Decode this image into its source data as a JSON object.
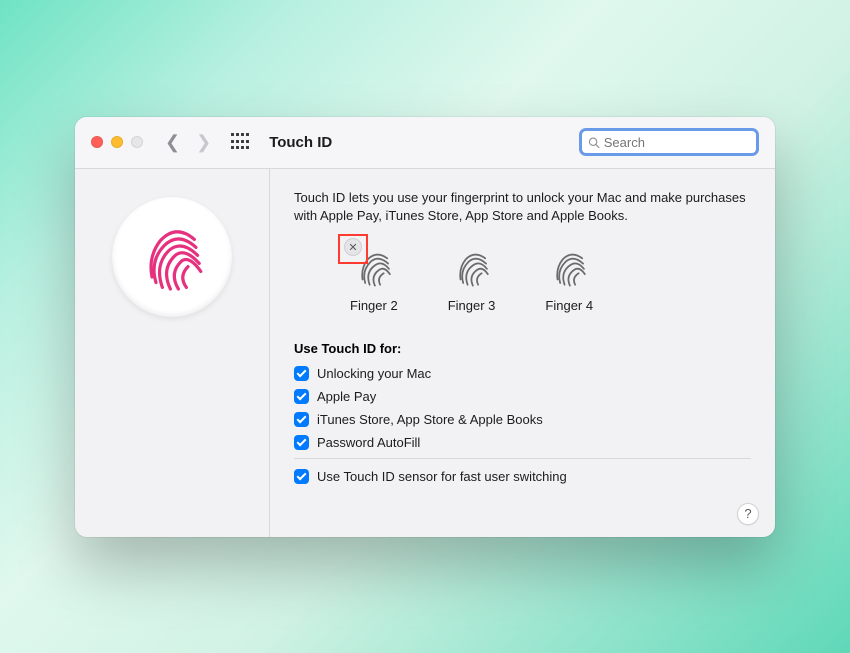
{
  "window": {
    "title": "Touch ID"
  },
  "search": {
    "placeholder": "Search"
  },
  "intro": "Touch ID lets you use your fingerprint to unlock your Mac and make purchases with Apple Pay, iTunes Store, App Store and Apple Books.",
  "fingers": [
    {
      "label": "Finger 2",
      "showDelete": true
    },
    {
      "label": "Finger 3",
      "showDelete": false
    },
    {
      "label": "Finger 4",
      "showDelete": false
    }
  ],
  "use_section": {
    "title": "Use Touch ID for:",
    "options": [
      {
        "label": "Unlocking your Mac",
        "checked": true
      },
      {
        "label": "Apple Pay",
        "checked": true
      },
      {
        "label": "iTunes Store, App Store & Apple Books",
        "checked": true
      },
      {
        "label": "Password AutoFill",
        "checked": true
      }
    ],
    "fast_switch": {
      "label": "Use Touch ID sensor for fast user switching",
      "checked": true
    }
  },
  "help": "?"
}
